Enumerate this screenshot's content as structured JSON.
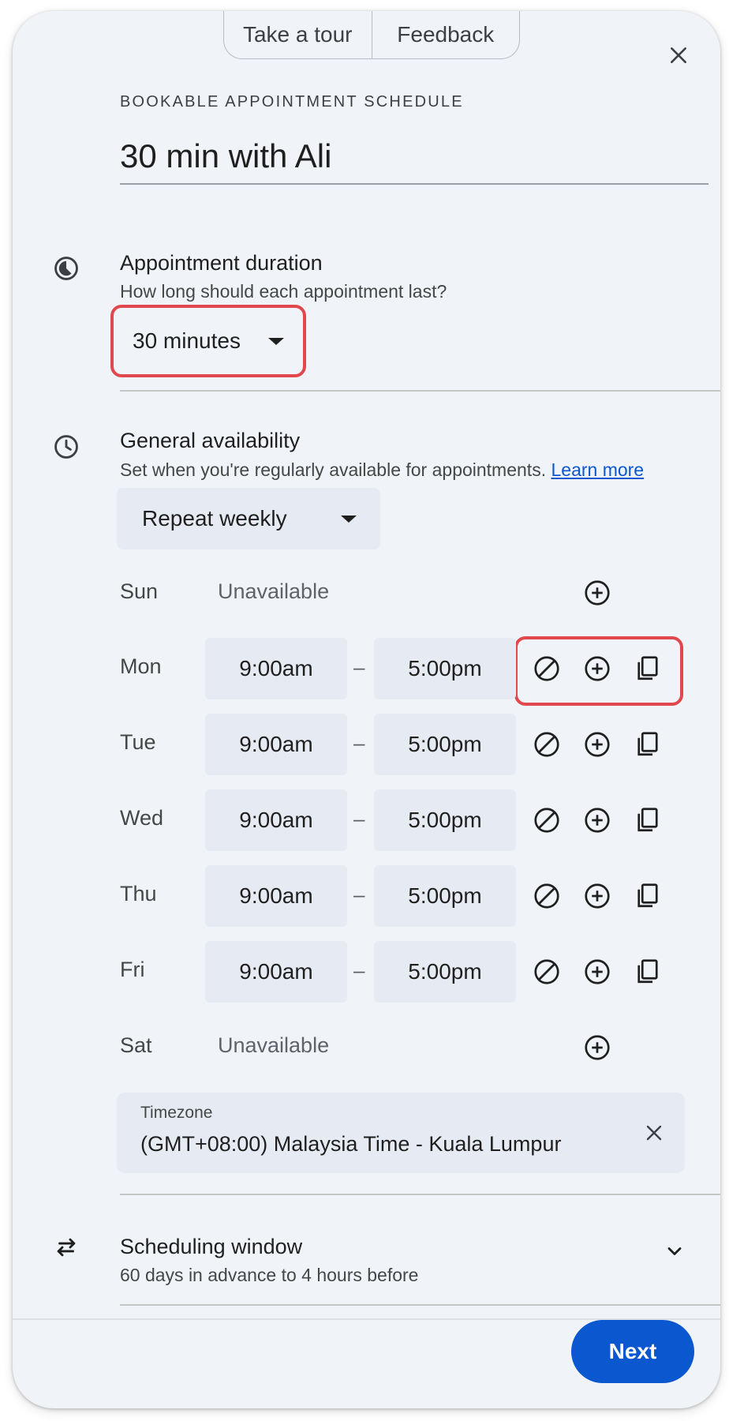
{
  "header": {
    "take_tour": "Take a tour",
    "feedback": "Feedback",
    "overline": "BOOKABLE APPOINTMENT SCHEDULE",
    "title": "30 min with Ali"
  },
  "duration": {
    "heading": "Appointment duration",
    "subtitle": "How long should each appointment last?",
    "selected": "30 minutes"
  },
  "availability": {
    "heading": "General availability",
    "subtitle": "Set when you're regularly available for appointments.",
    "learn_more": "Learn more",
    "repeat": "Repeat weekly",
    "separator": "–",
    "days": [
      {
        "day": "Sun",
        "status": "Unavailable"
      },
      {
        "day": "Mon",
        "start": "9:00am",
        "end": "5:00pm"
      },
      {
        "day": "Tue",
        "start": "9:00am",
        "end": "5:00pm"
      },
      {
        "day": "Wed",
        "start": "9:00am",
        "end": "5:00pm"
      },
      {
        "day": "Thu",
        "start": "9:00am",
        "end": "5:00pm"
      },
      {
        "day": "Fri",
        "start": "9:00am",
        "end": "5:00pm"
      },
      {
        "day": "Sat",
        "status": "Unavailable"
      }
    ]
  },
  "timezone": {
    "label": "Timezone",
    "value": "(GMT+08:00) Malaysia Time - Kuala Lumpur"
  },
  "scheduling": {
    "heading": "Scheduling window",
    "subtitle": "60 days in advance to 4 hours before"
  },
  "footer": {
    "next": "Next"
  },
  "icons": {
    "duration": "timelapse-icon",
    "availability": "clock-icon",
    "scheduling": "swap-arrows-icon",
    "row_actions": [
      "block-icon",
      "add-circle-icon",
      "copy-icon"
    ]
  },
  "colors": {
    "accent": "#0b57d0",
    "highlight": "#e0484e",
    "panel_bg": "#f0f4f9",
    "field_bg": "#e6ebf3"
  }
}
